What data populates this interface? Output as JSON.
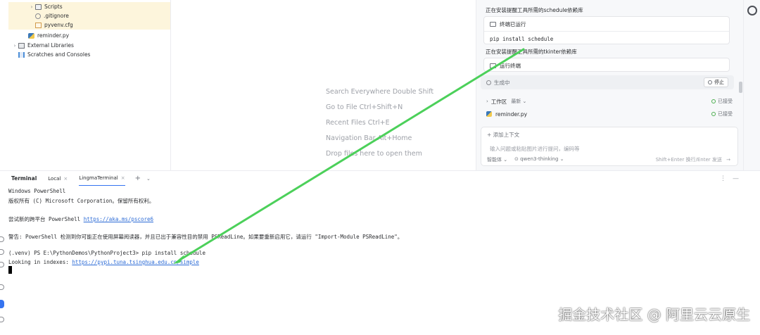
{
  "project_tree": {
    "items": [
      {
        "label": "Scripts",
        "arrow": "›",
        "icon": "folder-icon"
      },
      {
        "label": ".gitignore",
        "icon": "ignore-file-icon"
      },
      {
        "label": "pyvenv.cfg",
        "icon": "config-file-icon"
      },
      {
        "label": "reminder.py",
        "icon": "python-file-icon"
      },
      {
        "label": "External Libraries",
        "arrow": "›",
        "icon": "library-icon"
      },
      {
        "label": "Scratches and Consoles",
        "icon": "scratch-icon"
      }
    ]
  },
  "editor_empty": {
    "hints": [
      "Search Everywhere Double Shift",
      "Go to File Ctrl+Shift+N",
      "Recent Files Ctrl+E",
      "Navigation Bar Alt+Home",
      "Drop files here to open them"
    ]
  },
  "ai_panel": {
    "step1_title": "正在安装提醒工具所需的schedule依赖库",
    "step1_status": "终端已运行",
    "step1_command": "pip install schedule",
    "step2_title": "正在安装提醒工具所需的tkinter依赖库",
    "step2_status": "运行终端",
    "generating_label": "生成中",
    "stop_label": "停止",
    "workspace_label": "工作区",
    "workspace_sort": "最新",
    "workspace_status": "已接受",
    "workspace_file": "reminder.py",
    "workspace_file_status": "已接受",
    "add_context": "添加上下文",
    "input_placeholder": "输入问题或粘贴图片进行提问，编码等",
    "mode_label": "智能体",
    "model_label": "qwen3-thinking",
    "send_hint": "Shift+Enter 换行/Enter 发送"
  },
  "terminal": {
    "title": "Terminal",
    "tabs": [
      {
        "label": "Local",
        "active": false
      },
      {
        "label": "LingmaTerminal",
        "active": true
      }
    ],
    "lines": {
      "l1": "Windows PowerShell",
      "l2": "版权所有 (C) Microsoft Corporation。保留所有权利。",
      "l3_prefix": "尝试新的跨平台 PowerShell ",
      "l3_link": "https://aka.ms/pscore6",
      "l4": "警告: PowerShell 检测到你可能正在使用屏幕阅读器，并且已出于兼容性目的禁用 PSReadLine。如果要重新启用它，请运行 \"Import-Module PSReadLine\"。",
      "l5": "(.venv) PS E:\\PythonDemos\\PythonProject3> pip install schedule",
      "l6_prefix": "Looking in indexes: ",
      "l6_link": "https://pypi.tuna.tsinghua.edu.cn/simple"
    }
  },
  "watermark": "掘金技术社区 @ 阿里云云原生",
  "colors": {
    "accent": "#3574f0",
    "link": "#2c6bd6",
    "arrow_annotation": "#4cd05a",
    "tree_highlight": "#fdf5dc"
  }
}
